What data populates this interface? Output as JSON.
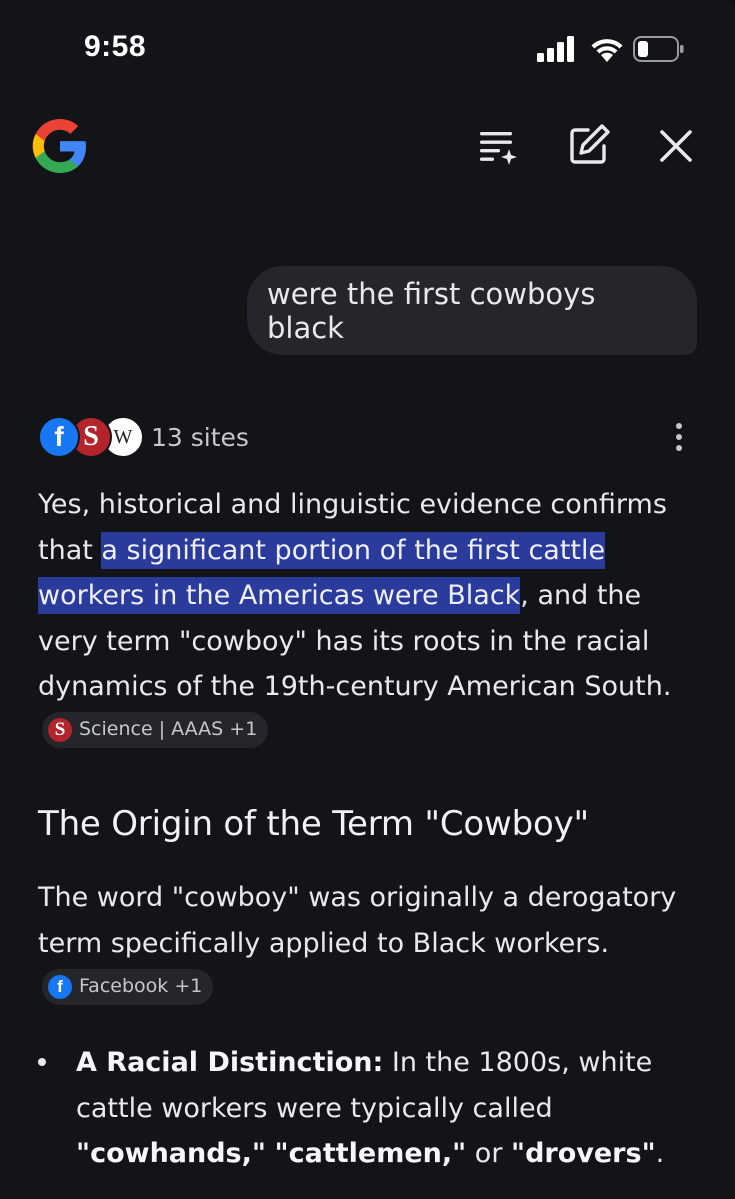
{
  "status_bar": {
    "time": "9:58"
  },
  "top_bar": {
    "logo": "google-logo",
    "actions": [
      "tune-icon",
      "edit-icon",
      "close-icon"
    ]
  },
  "query": {
    "text": "were the first cowboys black"
  },
  "sources": {
    "favicons": [
      "facebook",
      "science",
      "wikipedia"
    ],
    "count_label": "13 sites"
  },
  "answer": {
    "intro_before": "Yes, historical and linguistic evidence confirms that ",
    "intro_highlight": "a significant portion of the first cattle workers in the Americas were Black",
    "intro_after": ", and the very term \"cowboy\" has its roots in the racial dynamics of the 19th-century American South.",
    "intro_chip": {
      "icon_letter": "S",
      "label": "Science | AAAS +1"
    }
  },
  "section": {
    "heading": "The Origin of the Term \"Cowboy\"",
    "para_text": "The word \"cowboy\" was originally a derogatory term specifically applied to Black workers.",
    "para_chip": {
      "icon_letter": "f",
      "label": "Facebook +1"
    },
    "bullets": [
      {
        "title": "A Racial Distinction:",
        "text_before": " In the 1800s, white cattle workers were typically called ",
        "term1": "\"cowhands,\"",
        "term2": "\"cattlemen,\"",
        "between": " or ",
        "term3": "\"drovers\"",
        "end": "."
      }
    ]
  },
  "colors": {
    "background": "#131418",
    "highlight": "#2b3b9c",
    "chip_bg": "#25262b",
    "bubble_bg": "#25262b"
  }
}
